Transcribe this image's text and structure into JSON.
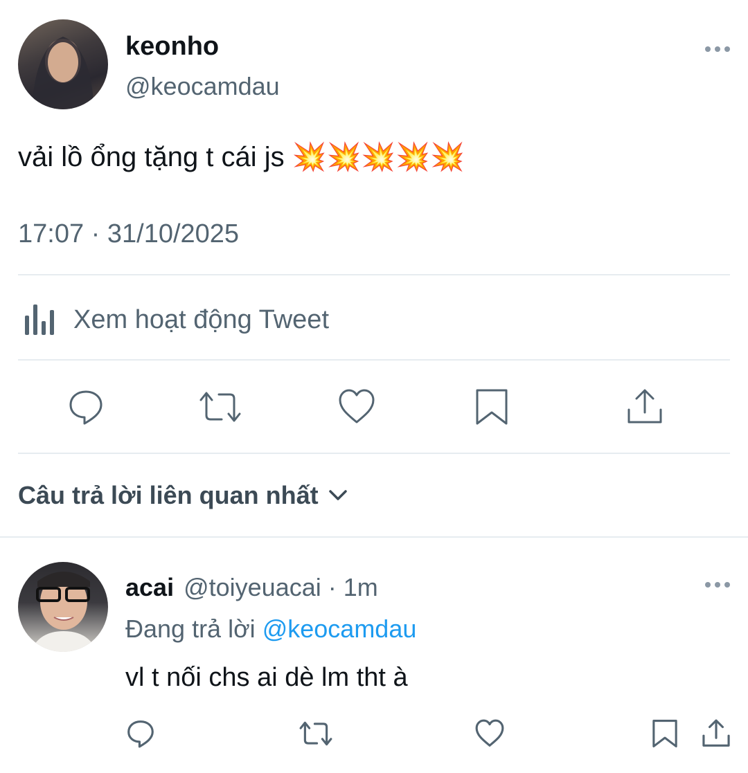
{
  "main_tweet": {
    "name": "keonho",
    "handle": "@keocamdau",
    "text": "vải lồ ổng tặng t cái js",
    "emojis": "💥💥💥💥💥",
    "time": "17:07 · 31/10/2025",
    "activity_label": "Xem hoạt động Tweet"
  },
  "replies_header": {
    "label": "Câu trả lời liên quan nhất"
  },
  "reply": {
    "name": "acai",
    "handle_meta": "@toiyeuacai · 1m",
    "replying_prefix": "Đang trả lời",
    "replying_handle": "@keocamdau",
    "text": "vl t nối chs ai dè lm tht à"
  },
  "colors": {
    "text": "#0f1419",
    "muted": "#536471",
    "link": "#1d9bf0",
    "divider": "#e6ecf0"
  },
  "icons": [
    "more-icon",
    "analytics-icon",
    "reply-icon",
    "retweet-icon",
    "like-icon",
    "bookmark-icon",
    "share-icon",
    "chevron-down-icon",
    "explosion-icon"
  ]
}
